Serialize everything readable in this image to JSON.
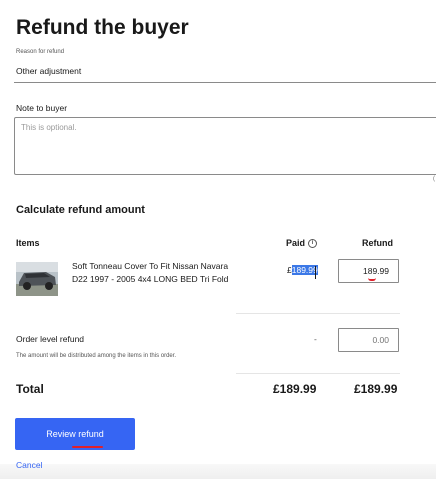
{
  "page": {
    "title": "Refund the buyer"
  },
  "reason": {
    "label": "Reason for refund",
    "value": "Other adjustment"
  },
  "note": {
    "label": "Note to buyer",
    "placeholder": "This is optional.",
    "counter": "("
  },
  "calculate": {
    "heading": "Calculate refund amount"
  },
  "table": {
    "columns": {
      "items": "Items",
      "paid": "Paid",
      "refund": "Refund"
    },
    "item": {
      "title": "Soft Tonneau Cover To Fit Nissan Navara D22 1997 - 2005 4x4 LONG BED Tri Fold",
      "paid_prefix": "£",
      "paid_selected": "189.99",
      "refund_value": "189.99"
    },
    "order_level": {
      "label": "Order level refund",
      "note": "The amount will be distributed among the items in this order.",
      "paid": "-",
      "refund_placeholder": "0.00"
    },
    "total": {
      "label": "Total",
      "paid": "£189.99",
      "refund": "£189.99"
    }
  },
  "actions": {
    "review_label": "Review refund",
    "cancel_label": "Cancel"
  },
  "colors": {
    "primary": "#3665f3",
    "selection": "#3b78e7",
    "spellcheck": "#e0202a"
  },
  "icons": {
    "paid_info": "info-circle-icon",
    "item_thumb": "truck-bed-photo"
  }
}
